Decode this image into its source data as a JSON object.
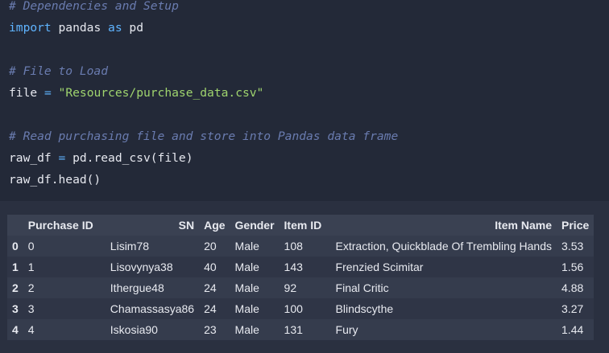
{
  "code": {
    "comment_setup": "# Dependencies and Setup",
    "import_kw": "import",
    "import_mod": "pandas",
    "as_kw": "as",
    "alias": "pd",
    "comment_file": "# File to Load",
    "file_var": "file",
    "assign_op": "=",
    "file_path": "\"Resources/purchase_data.csv\"",
    "comment_read": "# Read purchasing file and store into Pandas data frame",
    "raw_var": "raw_df",
    "read_call": "pd.read_csv(file)",
    "head_call": "raw_df.head()"
  },
  "table": {
    "columns": [
      "Purchase ID",
      "SN",
      "Age",
      "Gender",
      "Item ID",
      "Item Name",
      "Price"
    ],
    "rows": [
      {
        "index": "0",
        "cells": [
          "0",
          "Lisim78",
          "20",
          "Male",
          "108",
          "Extraction, Quickblade Of Trembling Hands",
          "3.53"
        ]
      },
      {
        "index": "1",
        "cells": [
          "1",
          "Lisovynya38",
          "40",
          "Male",
          "143",
          "Frenzied Scimitar",
          "1.56"
        ]
      },
      {
        "index": "2",
        "cells": [
          "2",
          "Ithergue48",
          "24",
          "Male",
          "92",
          "Final Critic",
          "4.88"
        ]
      },
      {
        "index": "3",
        "cells": [
          "3",
          "Chamassasya86",
          "24",
          "Male",
          "100",
          "Blindscythe",
          "3.27"
        ]
      },
      {
        "index": "4",
        "cells": [
          "4",
          "Iskosia90",
          "23",
          "Male",
          "131",
          "Fury",
          "1.44"
        ]
      }
    ]
  }
}
